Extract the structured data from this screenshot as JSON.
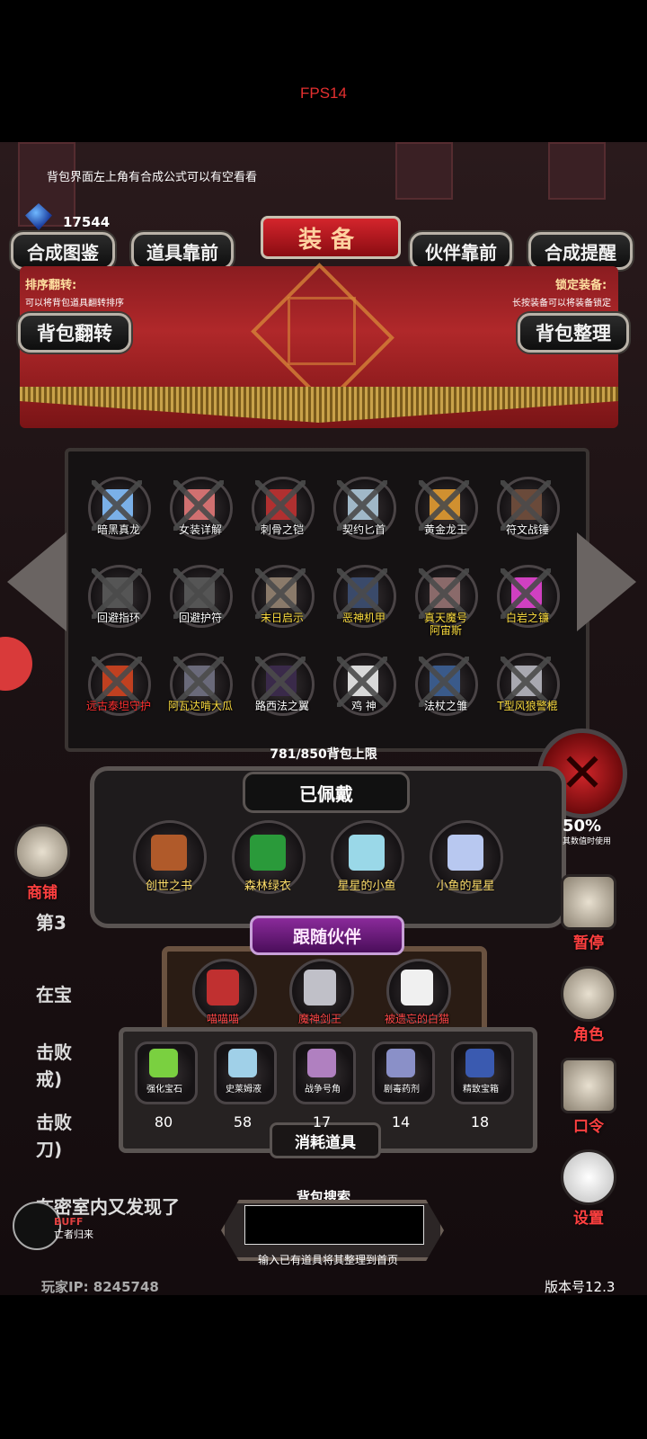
{
  "fps_label": "FPS14",
  "tip_text": "背包界面左上角有合成公式可以有空看看",
  "currency": {
    "icon": "blue-gem-icon",
    "amount": "17544"
  },
  "title": "装备",
  "top_buttons": {
    "synthesis_guide": "合成图鉴",
    "items_first": "道具靠前",
    "partner_first": "伙伴靠前",
    "synthesis_reminder": "合成提醒"
  },
  "sort": {
    "flip_title": "排序翻转:",
    "flip_desc": "可以将背包道具翻转排序",
    "lock_title": "锁定装备:",
    "lock_desc": "长按装备可以将装备锁定"
  },
  "bag_buttons": {
    "flip": "背包翻转",
    "organize": "背包整理"
  },
  "grid_items": [
    {
      "name": "暗黑真龙",
      "color": "#7ab0e8",
      "name_color": "#ffffff"
    },
    {
      "name": "女装详解",
      "color": "#d07070",
      "name_color": "#ffffff"
    },
    {
      "name": "刺骨之铠",
      "color": "#b03030",
      "name_color": "#ffffff"
    },
    {
      "name": "契约匕首",
      "color": "#a0b8c8",
      "name_color": "#ffffff"
    },
    {
      "name": "黄金龙王",
      "color": "#d09030",
      "name_color": "#ffffff"
    },
    {
      "name": "符文战锤",
      "color": "#6a4a3a",
      "name_color": "#ffffff"
    },
    {
      "name": "回避指环",
      "color": "#555555",
      "name_color": "#ffffff"
    },
    {
      "name": "回避护符",
      "color": "#555555",
      "name_color": "#ffffff"
    },
    {
      "name": "末日启示",
      "color": "#8a7a6a",
      "name_color": "#ffdf40"
    },
    {
      "name": "恶神机甲",
      "color": "#3a4a6a",
      "name_color": "#ffdf40"
    },
    {
      "name": "真天魔号\n阿宙斯",
      "color": "#8a6a6a",
      "name_color": "#ffdf40"
    },
    {
      "name": "白岩之镰",
      "color": "#d040c0",
      "name_color": "#ffdf40"
    },
    {
      "name": "远古泰坦守护",
      "color": "#c04020",
      "name_color": "#ff3030"
    },
    {
      "name": "阿瓦达啃大瓜",
      "color": "#6a6a7a",
      "name_color": "#ffdf40"
    },
    {
      "name": "路西法之翼",
      "color": "#3a2a4a",
      "name_color": "#ffffff"
    },
    {
      "name": "鸡 神",
      "color": "#d8d8d8",
      "name_color": "#ffffff"
    },
    {
      "name": "法杖之雏",
      "color": "#3a5a8a",
      "name_color": "#ffffff"
    },
    {
      "name": "T型风狼警棍",
      "color": "#a8a8b0",
      "name_color": "#ffdf40"
    }
  ],
  "capacity": "781/850背包上限",
  "worn": {
    "title": "已佩戴",
    "items": [
      {
        "name": "创世之书",
        "color": "#b05a2a"
      },
      {
        "name": "森林绿衣",
        "color": "#2a9a3a"
      },
      {
        "name": "星星的小鱼",
        "color": "#9ad8e8"
      },
      {
        "name": "小鱼的星星",
        "color": "#b8c8f0"
      }
    ]
  },
  "companions": {
    "title": "跟随伙伴",
    "items": [
      {
        "name": "喵喵喵",
        "color": "#c03030"
      },
      {
        "name": "魔神剑王",
        "color": "#c0c0c8"
      },
      {
        "name": "被遗忘的白猫",
        "color": "#f0f0f0"
      }
    ]
  },
  "consumables": {
    "title": "消耗道具",
    "items": [
      {
        "name": "强化宝石",
        "qty": "80",
        "color": "#7ad040"
      },
      {
        "name": "史莱姆液",
        "qty": "58",
        "color": "#a0d0e8"
      },
      {
        "name": "战争号角",
        "qty": "17",
        "color": "#b080c0"
      },
      {
        "name": "剧毒药剂",
        "qty": "14",
        "color": "#8a90c8"
      },
      {
        "name": "精致宝箱",
        "qty": "18",
        "color": "#3a5ab0"
      }
    ]
  },
  "search": {
    "label": "背包搜索",
    "value": "",
    "hint": "输入已有道具将其整理到首页"
  },
  "side_menu": {
    "shop": "商铺",
    "pause": "暂停",
    "role": "角色",
    "password": "口令",
    "settings": "设置",
    "stats_pct": "50%",
    "stats_sub": "其数值时使用"
  },
  "background_log": {
    "line1": "第3",
    "line2": "在宝",
    "line3": "击败",
    "line4": "戒)",
    "line5": "击败",
    "line6": "刀)",
    "line7": "在密室内又发现了"
  },
  "buff": {
    "label": "BUFF",
    "sub": "亡者归来"
  },
  "footer": {
    "player_ip": "玩家IP: 8245748",
    "version": "版本号12.3"
  }
}
